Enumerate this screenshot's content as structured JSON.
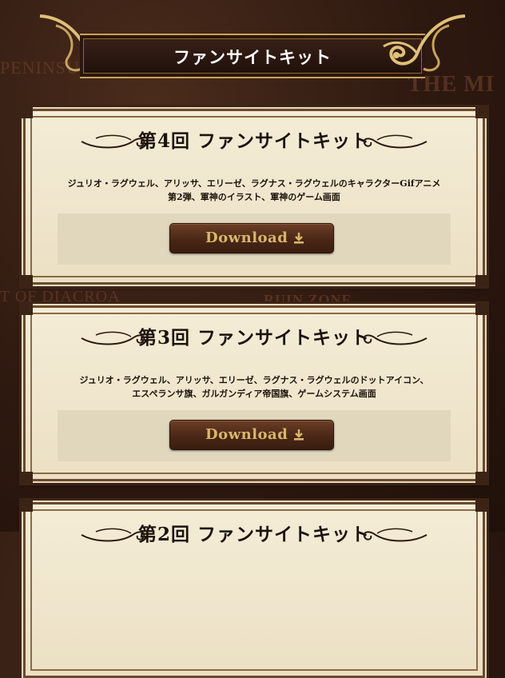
{
  "map_words": [
    "PENINSULA",
    "THE MI",
    "T OF DIACROA",
    "RUIN ZONE"
  ],
  "header": {
    "title": "ファンサイトキット"
  },
  "kits": [
    {
      "title": "第4回 ファンサイトキット",
      "desc_line1": "ジュリオ・ラグウェル、アリッサ、エリーゼ、ラグナス・ラグウェルのキャラクターGifアニメ",
      "desc_line2": "第2弾、軍神のイラスト、軍神のゲーム画面",
      "button_label": "Download"
    },
    {
      "title": "第3回 ファンサイトキット",
      "desc_line1": "ジュリオ・ラグウェル、アリッサ、エリーゼ、ラグナス・ラグウェルのドットアイコン、",
      "desc_line2": "エスペランサ旗、ガルガンディア帝国旗、ゲームシステム画面",
      "button_label": "Download"
    },
    {
      "title": "第2回 ファンサイトキット"
    }
  ],
  "colors": {
    "gold": "#d8b66a",
    "button_brown": "#4a2716",
    "panel_bg": "#f4ecd6"
  },
  "icons": [
    "flourish-left-icon",
    "flourish-right-icon",
    "scroll-ornament-icon",
    "download-icon"
  ]
}
